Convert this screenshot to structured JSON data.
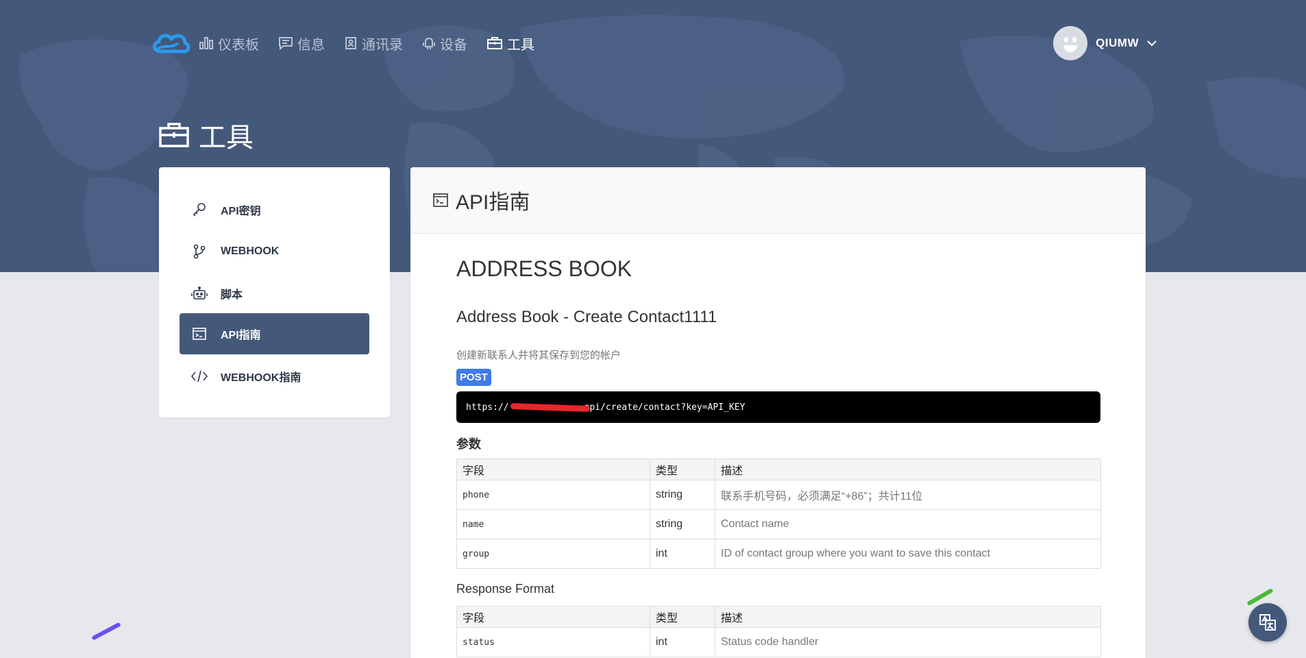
{
  "colors": {
    "header_bg": "#44587a",
    "accent": "#3f7be8",
    "code_bg": "#000000",
    "badge": "#3f7be8"
  },
  "nav": {
    "items": [
      {
        "label": "仪表板",
        "icon": "bar-chart-icon"
      },
      {
        "label": "信息",
        "icon": "message-icon"
      },
      {
        "label": "通讯录",
        "icon": "contacts-icon"
      },
      {
        "label": "设备",
        "icon": "android-icon"
      },
      {
        "label": "工具",
        "icon": "briefcase-icon",
        "active": true
      }
    ],
    "user": {
      "name": "QIUMW"
    }
  },
  "page": {
    "title": "工具"
  },
  "sidebar": {
    "items": [
      {
        "label": "API密钥",
        "icon": "key-icon"
      },
      {
        "label": "WEBHOOK",
        "icon": "git-branch-icon"
      },
      {
        "label": "脚本",
        "icon": "robot-icon"
      },
      {
        "label": "API指南",
        "icon": "terminal-icon",
        "active": true
      },
      {
        "label": "WEBHOOK指南",
        "icon": "code-icon"
      }
    ]
  },
  "panel": {
    "title": "API指南",
    "section": "ADDRESS BOOK",
    "subsection": "Address Book - Create Contact1111",
    "description": "创建新联系人并将其保存到您的帐户",
    "method": "POST",
    "url_prefix": "https://",
    "url_suffix": "api/create/contact?key=API_KEY",
    "params_heading": "参数",
    "params_columns": [
      "字段",
      "类型",
      "描述"
    ],
    "params_rows": [
      [
        "phone",
        "string",
        "联系手机号码，必须满足“+86”；共计11位"
      ],
      [
        "name",
        "string",
        "Contact name"
      ],
      [
        "group",
        "int",
        "ID of contact group where you want to save this contact"
      ]
    ],
    "response_heading": "Response Format",
    "response_columns": [
      "字段",
      "类型",
      "描述"
    ],
    "response_rows": [
      [
        "status",
        "int",
        "Status code handler"
      ]
    ]
  }
}
